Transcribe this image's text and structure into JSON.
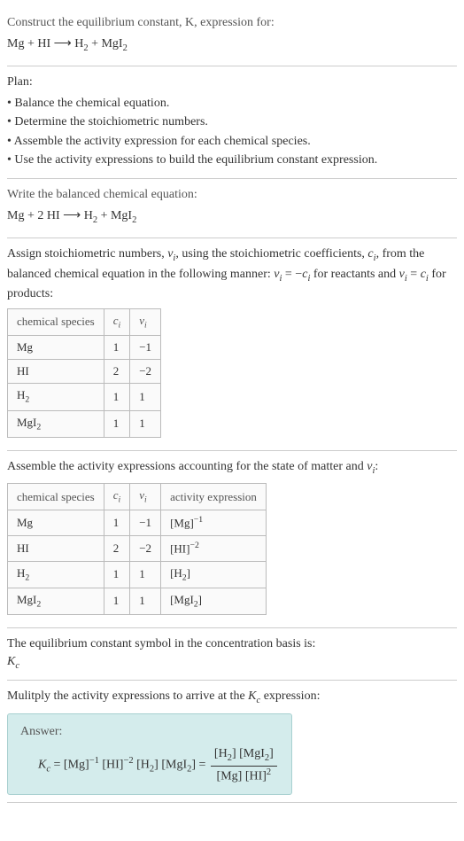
{
  "section1": {
    "prompt": "Construct the equilibrium constant, K, expression for:",
    "left1": "Mg + HI",
    "arrow": "⟶",
    "right1": "H",
    "right1sub": "2",
    "right2": " + MgI",
    "right2sub": "2"
  },
  "plan": {
    "heading": "Plan:",
    "b1": "• Balance the chemical equation.",
    "b2": "• Determine the stoichiometric numbers.",
    "b3": "• Assemble the activity expression for each chemical species.",
    "b4": "• Use the activity expressions to build the equilibrium constant expression."
  },
  "balanced": {
    "heading": "Write the balanced chemical equation:",
    "left": "Mg + 2 HI",
    "arrow": "⟶",
    "r1": "H",
    "r1sub": "2",
    "r2": " + MgI",
    "r2sub": "2"
  },
  "stoich": {
    "intro1": "Assign stoichiometric numbers, ",
    "nu": "ν",
    "isub": "i",
    "intro2": ", using the stoichiometric coefficients, ",
    "c": "c",
    "intro3": ", from the balanced chemical equation in the following manner: ",
    "eq1a": "ν",
    "eq1b": " = −",
    "eq1c": "c",
    "intro4": " for reactants and ",
    "eq2a": "ν",
    "eq2b": " = ",
    "eq2c": "c",
    "intro5": " for products:",
    "h1": "chemical species",
    "h2a": "c",
    "h2b": "i",
    "h3a": "ν",
    "h3b": "i",
    "r1c1": "Mg",
    "r1c2": "1",
    "r1c3": "−1",
    "r2c1": "HI",
    "r2c2": "2",
    "r2c3": "−2",
    "r3c1a": "H",
    "r3c1b": "2",
    "r3c2": "1",
    "r3c3": "1",
    "r4c1a": "MgI",
    "r4c1b": "2",
    "r4c2": "1",
    "r4c3": "1"
  },
  "activity": {
    "intro1": "Assemble the activity expressions accounting for the state of matter and ",
    "nu": "ν",
    "isub": "i",
    "intro2": ":",
    "h1": "chemical species",
    "h2a": "c",
    "h2b": "i",
    "h3a": "ν",
    "h3b": "i",
    "h4": "activity expression",
    "r1c1": "Mg",
    "r1c2": "1",
    "r1c3": "−1",
    "r1c4a": "[Mg]",
    "r1c4b": "−1",
    "r2c1": "HI",
    "r2c2": "2",
    "r2c3": "−2",
    "r2c4a": "[HI]",
    "r2c4b": "−2",
    "r3c1a": "H",
    "r3c1b": "2",
    "r3c2": "1",
    "r3c3": "1",
    "r3c4a": "[H",
    "r3c4b": "2",
    "r3c4c": "]",
    "r4c1a": "MgI",
    "r4c1b": "2",
    "r4c2": "1",
    "r4c3": "1",
    "r4c4a": "[MgI",
    "r4c4b": "2",
    "r4c4c": "]"
  },
  "symbol": {
    "text": "The equilibrium constant symbol in the concentration basis is:",
    "Ka": "K",
    "Kb": "c"
  },
  "multiply": {
    "text1": "Mulitply the activity expressions to arrive at the ",
    "Ka": "K",
    "Kb": "c",
    "text2": " expression:"
  },
  "answer": {
    "label": "Answer:",
    "Ka": "K",
    "Kb": "c",
    "eq": " = [Mg]",
    "e1": "−1",
    "t2": " [HI]",
    "e2": "−2",
    "t3": " [H",
    "s3": "2",
    "t4": "] [MgI",
    "s4": "2",
    "t5": "] = ",
    "num1": "[H",
    "num1s": "2",
    "num2": "] [MgI",
    "num2s": "2",
    "num3": "]",
    "den1": "[Mg] [HI]",
    "den1e": "2"
  },
  "chart_data": {
    "type": "table",
    "tables": [
      {
        "title": "Stoichiometric numbers",
        "columns": [
          "chemical species",
          "c_i",
          "ν_i"
        ],
        "rows": [
          [
            "Mg",
            1,
            -1
          ],
          [
            "HI",
            2,
            -2
          ],
          [
            "H2",
            1,
            1
          ],
          [
            "MgI2",
            1,
            1
          ]
        ]
      },
      {
        "title": "Activity expressions",
        "columns": [
          "chemical species",
          "c_i",
          "ν_i",
          "activity expression"
        ],
        "rows": [
          [
            "Mg",
            1,
            -1,
            "[Mg]^-1"
          ],
          [
            "HI",
            2,
            -2,
            "[HI]^-2"
          ],
          [
            "H2",
            1,
            1,
            "[H2]"
          ],
          [
            "MgI2",
            1,
            1,
            "[MgI2]"
          ]
        ]
      }
    ]
  }
}
